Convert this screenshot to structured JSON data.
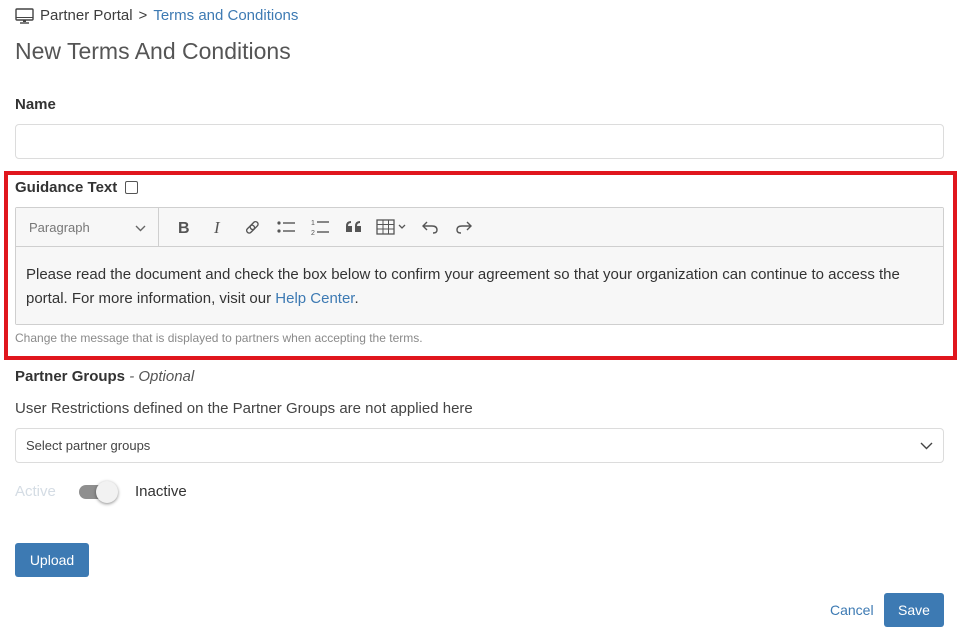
{
  "breadcrumb": {
    "icon": "monitor-icon",
    "root": "Partner Portal",
    "separator": ">",
    "current": "Terms and Conditions"
  },
  "page_title": "New Terms And Conditions",
  "name_field": {
    "label": "Name",
    "value": "",
    "placeholder": ""
  },
  "guidance": {
    "label": "Guidance Text",
    "checkbox_checked": false,
    "toolbar": {
      "block_format": "Paragraph",
      "buttons": [
        "bold-icon",
        "italic-icon",
        "link-icon",
        "bulleted-list-icon",
        "numbered-list-icon",
        "blockquote-icon",
        "table-icon",
        "undo-icon",
        "redo-icon"
      ]
    },
    "body_text": "Please read the document and check the box below to confirm your agreement so that your organization can continue to access the portal. For more information, visit our ",
    "body_link": "Help Center",
    "body_end": ".",
    "hint": "Change the message that is displayed to partners when accepting the terms."
  },
  "partner_groups": {
    "label": "Partner Groups",
    "optional": "- Optional",
    "description": "User Restrictions defined on the Partner Groups are not applied here",
    "select_placeholder": "Select partner groups"
  },
  "status_toggle": {
    "active_label": "Active",
    "inactive_label": "Inactive",
    "is_active": false
  },
  "buttons": {
    "upload": "Upload",
    "cancel": "Cancel",
    "save": "Save"
  },
  "colors": {
    "accent": "#3d7ab3",
    "highlight_border": "#e0161d"
  }
}
